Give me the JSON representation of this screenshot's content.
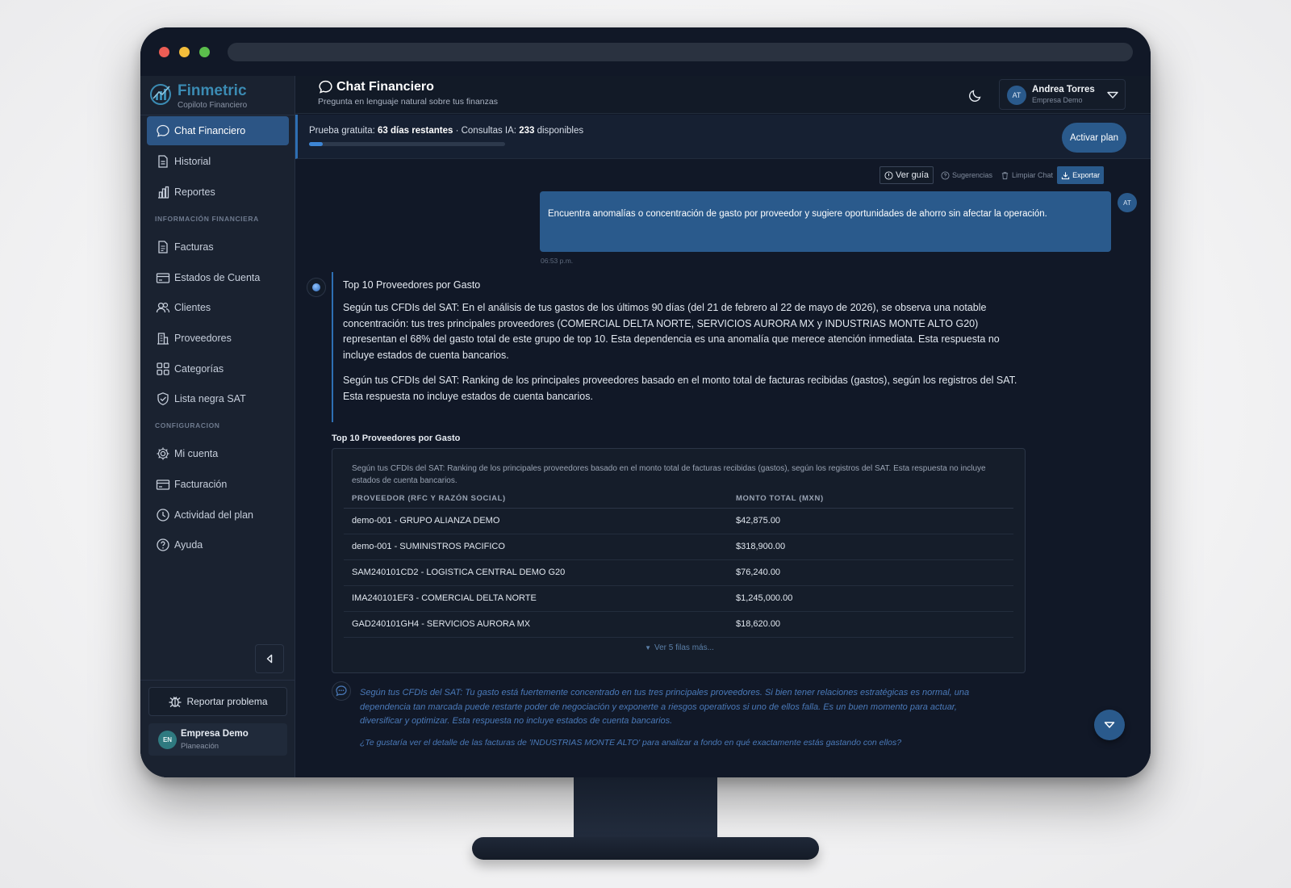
{
  "brand": {
    "name": "Finmetric",
    "subtitle": "Copiloto Financiero"
  },
  "header": {
    "title": "Chat Financiero",
    "subtitle": "Pregunta en lenguaje natural sobre tus finanzas",
    "user_initials": "AT",
    "user_name": "Andrea Torres",
    "user_company": "Empresa Demo"
  },
  "sidebar": {
    "items": [
      {
        "label": "Chat Financiero",
        "icon": "chat-icon",
        "active": true
      },
      {
        "label": "Historial",
        "icon": "document-icon"
      },
      {
        "label": "Reportes",
        "icon": "bar-chart-icon"
      }
    ],
    "section_info": "INFORMACIÓN FINANCIERA",
    "info_items": [
      {
        "label": "Facturas",
        "icon": "invoice-icon"
      },
      {
        "label": "Estados de Cuenta",
        "icon": "card-icon"
      },
      {
        "label": "Clientes",
        "icon": "users-icon"
      },
      {
        "label": "Proveedores",
        "icon": "building-icon"
      },
      {
        "label": "Categorías",
        "icon": "grid-icon"
      },
      {
        "label": "Lista negra SAT",
        "icon": "shield-icon"
      }
    ],
    "section_config": "CONFIGURACION",
    "config_items": [
      {
        "label": "Mi cuenta",
        "icon": "gear-icon"
      },
      {
        "label": "Facturación",
        "icon": "card-icon"
      },
      {
        "label": "Actividad del plan",
        "icon": "clock-icon"
      },
      {
        "label": "Ayuda",
        "icon": "help-icon"
      }
    ],
    "report_label": "Reportar problema",
    "company_initials": "EN",
    "company_name": "Empresa Demo",
    "company_plan": "Planeación"
  },
  "trial": {
    "prefix": "Prueba gratuita: ",
    "days": "63 días restantes",
    "middle": " · Consultas IA: ",
    "queries": "233",
    "suffix": " disponibles",
    "progress": 0.07,
    "activate_label": "Activar plan"
  },
  "toolbar": {
    "guide": "Ver guía",
    "suggestions": "Sugerencias",
    "clear": "Limpiar Chat",
    "export": "Exportar"
  },
  "chat": {
    "user_message": "Encuentra anomalías o concentración de gasto por proveedor y sugiere oportunidades de ahorro sin afectar la operación.",
    "user_initials": "AT",
    "time": "06:53 p.m.",
    "bot_title": "Top 10 Proveedores por Gasto",
    "bot_p1": "Según tus CFDIs del SAT: En el análisis de tus gastos de los últimos 90 días (del 21 de febrero al 22 de mayo de 2026), se observa una notable concentración: tus tres principales proveedores (COMERCIAL DELTA NORTE, SERVICIOS AURORA MX y INDUSTRIAS MONTE ALTO G20) representan el 68% del gasto total de este grupo de top 10. Esta dependencia es una anomalía que merece atención inmediata. Esta respuesta no incluye estados de cuenta bancarios.",
    "bot_p2": "Según tus CFDIs del SAT: Ranking de los principales proveedores basado en el monto total de facturas recibidas (gastos), según los registros del SAT. Esta respuesta no incluye estados de cuenta bancarios."
  },
  "table": {
    "title": "Top 10 Proveedores por Gasto",
    "note": "Según tus CFDIs del SAT: Ranking de los principales proveedores basado en el monto total de facturas recibidas (gastos), según los registros del SAT. Esta respuesta no incluye estados de cuenta bancarios.",
    "columns": [
      "PROVEEDOR (RFC Y RAZÓN SOCIAL)",
      "MONTO TOTAL (MXN)"
    ],
    "rows": [
      [
        "demo-001 - GRUPO ALIANZA DEMO",
        "$42,875.00"
      ],
      [
        "demo-001 - SUMINISTROS PACIFICO",
        "$318,900.00"
      ],
      [
        "SAM240101CD2 - LOGISTICA CENTRAL DEMO G20",
        "$76,240.00"
      ],
      [
        "IMA240101EF3 - COMERCIAL DELTA NORTE",
        "$1,245,000.00"
      ],
      [
        "GAD240101GH4 - SERVICIOS AURORA MX",
        "$18,620.00"
      ]
    ],
    "more": "Ver 5 filas más..."
  },
  "insight": {
    "text": "Según tus CFDIs del SAT: Tu gasto está fuertemente concentrado en tus tres principales proveedores. Si bien tener relaciones estratégicas es normal, una dependencia tan marcada puede restarte poder de negociación y exponerte a riesgos operativos si uno de ellos falla. Es un buen momento para actuar, diversificar y optimizar. Esta respuesta no incluye estados de cuenta bancarios.",
    "question": "¿Te gustaría ver el detalle de las facturas de 'INDUSTRIAS MONTE ALTO' para analizar a fondo en qué exactamente estás gastando con ellos?"
  },
  "colors": {
    "accent": "#2a5a8c",
    "brand": "#3b8bb3",
    "background": "#111827",
    "sidebar": "#1a2230"
  }
}
